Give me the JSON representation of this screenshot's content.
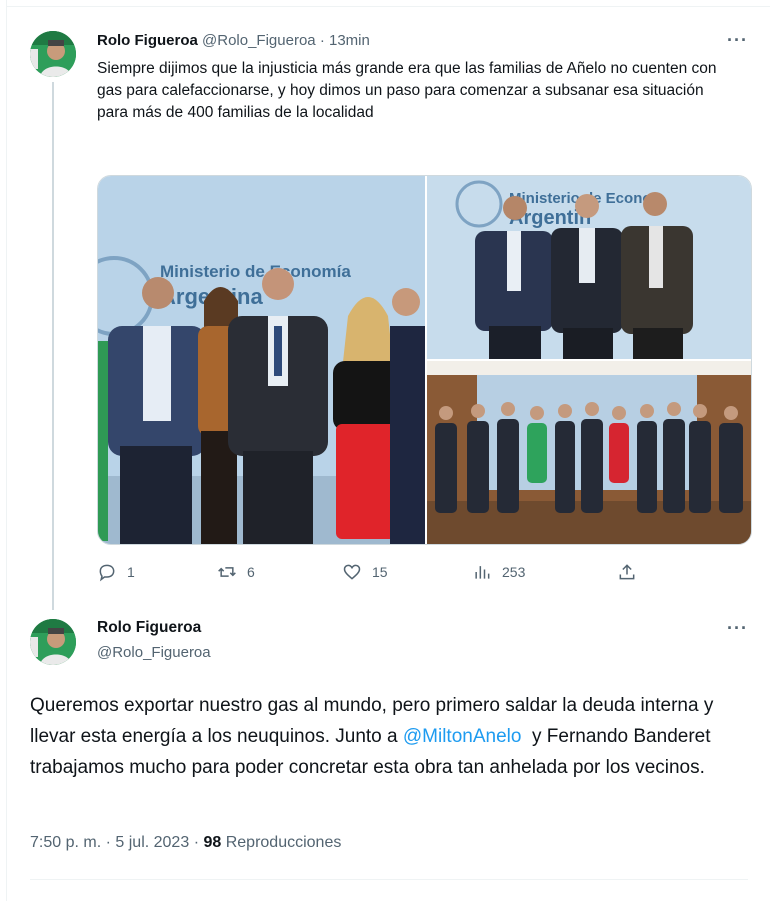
{
  "tweet1": {
    "author_name": "Rolo Figueroa",
    "handle": "@Rolo_Figueroa",
    "separator": "·",
    "time": "13min",
    "more": "···",
    "text": "Siempre dijimos que la injusticia más grande era que las familias de Añelo no cuenten con gas para calefaccionarse, y hoy dimos un paso para comenzar a subsanar esa situación para más de 400 familias de la localidad",
    "photo1_sign": "Ministerio de Economía",
    "photo1_sign2": "Argentina",
    "photo2_sign": "Ministerio de Econo",
    "photo2_sign2": "Argentin",
    "actions": {
      "replies": "1",
      "retweets": "6",
      "likes": "15",
      "views": "253"
    }
  },
  "tweet2": {
    "author_name": "Rolo Figueroa",
    "handle": "@Rolo_Figueroa",
    "more": "···",
    "text_part1": "Queremos exportar nuestro gas al mundo, pero primero saldar la deuda interna y llevar esta energía a los neuquinos. Junto a ",
    "mention": "@MiltonAnelo",
    "text_part2": "  y Fernando Banderet trabajamos mucho para poder concretar esta obra tan anhelada por los vecinos.",
    "time": "7:50 p. m.",
    "date_sep": "·",
    "date": "5 jul. 2023",
    "views_sep": "·",
    "views_count": "98",
    "views_label": "Reproducciones"
  },
  "colors": {
    "accent": "#1d9bf0",
    "muted": "#536471",
    "text": "#0f1419",
    "divider": "#eff3f4"
  },
  "icons": [
    "reply-icon",
    "retweet-icon",
    "like-icon",
    "views-icon",
    "share-icon",
    "more-icon"
  ]
}
